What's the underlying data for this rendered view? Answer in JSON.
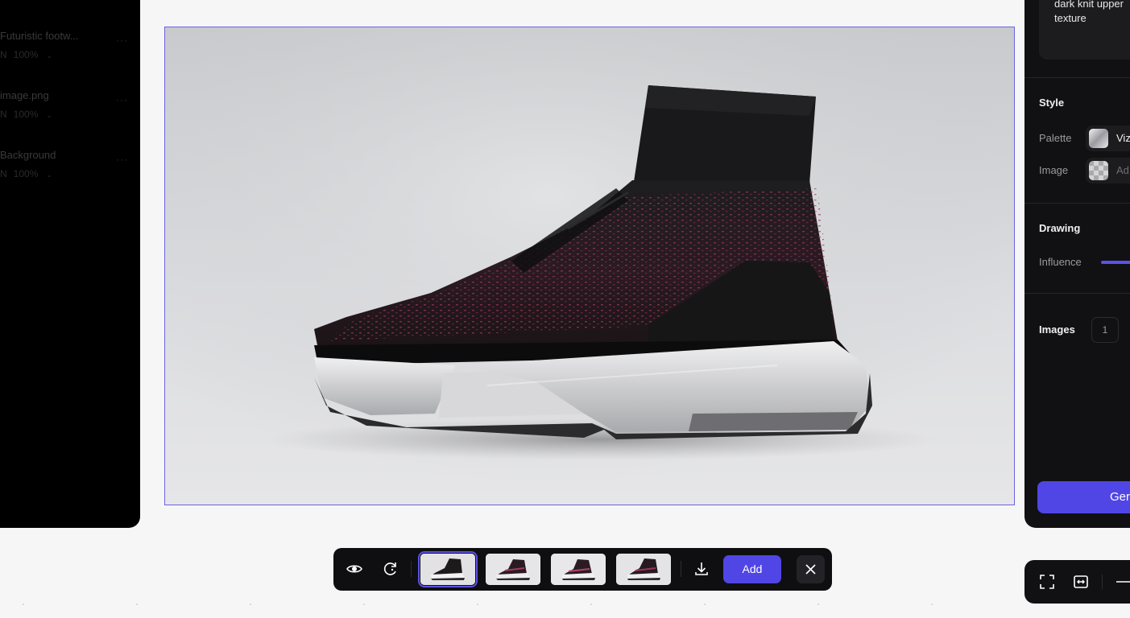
{
  "layers": [
    {
      "name": "Futuristic footw...",
      "mode": "N",
      "opacity": "100%"
    },
    {
      "name": "image.png",
      "mode": "N",
      "opacity": "100%"
    },
    {
      "name": "Background",
      "mode": "N",
      "opacity": "100%"
    }
  ],
  "canvas": {
    "subject": "high-top knit sneaker with chunky white sole"
  },
  "properties": {
    "prompt_text": [
      "dark knit upper",
      "texture"
    ],
    "style": {
      "title": "Style",
      "palette_label": "Palette",
      "palette_value": "Viz",
      "image_label": "Image",
      "image_value": "Ad"
    },
    "drawing": {
      "title": "Drawing",
      "influence_label": "Influence"
    },
    "images": {
      "title": "Images",
      "count": "1"
    },
    "generate_label": "Ger"
  },
  "toolbar": {
    "add_label": "Add",
    "thumbnails": [
      "variation-1",
      "variation-2",
      "variation-3",
      "variation-4"
    ],
    "selected_index": 0
  },
  "colors": {
    "accent": "#5046e5",
    "panel_dark": "#111113",
    "canvas_bg": "#f6f6f7"
  }
}
